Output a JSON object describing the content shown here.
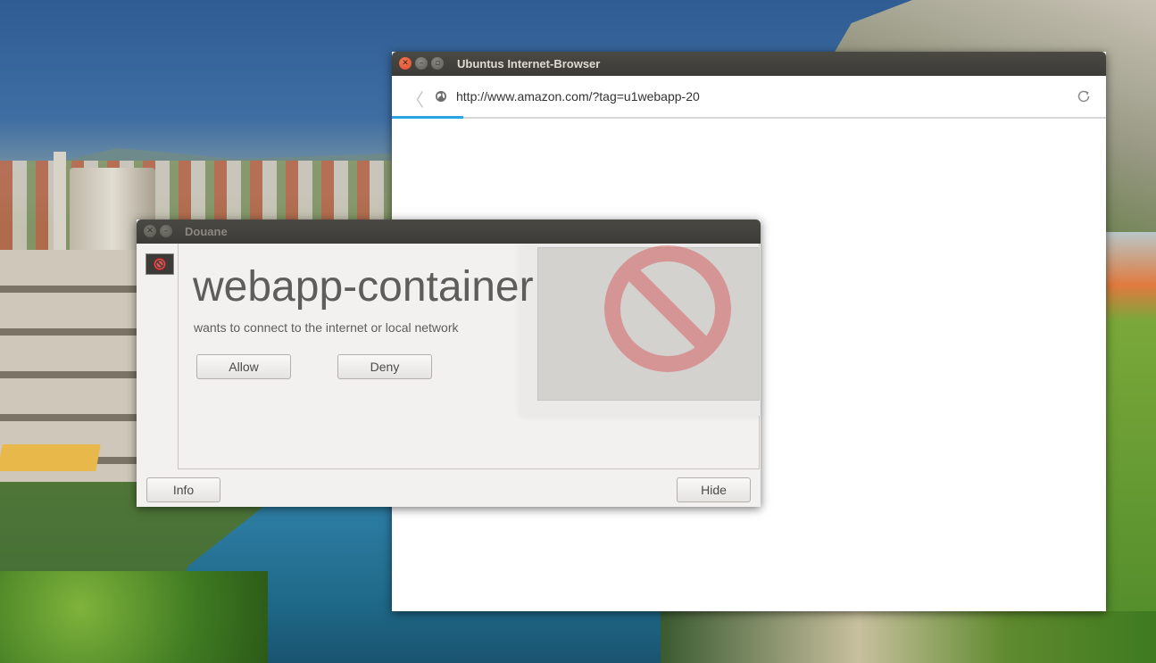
{
  "browser": {
    "title": "Ubuntus Internet-Browser",
    "url": "http://www.amazon.com/?tag=u1webapp-20",
    "load_progress_fraction": 0.1,
    "icons": {
      "back": "chevron-left-icon",
      "site": "globe-icon",
      "reload": "reload-icon"
    }
  },
  "douane": {
    "title": "Douane",
    "app_name": "webapp-container",
    "message": "wants to connect to the internet or local network",
    "allow_label": "Allow",
    "deny_label": "Deny",
    "info_label": "Info",
    "hide_label": "Hide",
    "icon": "forbidden-icon"
  },
  "colors": {
    "title_bar": "#3c3b37",
    "close_button": "#df4a24",
    "progress": "#2aa4e0",
    "forbidden_red": "#d9252b"
  }
}
